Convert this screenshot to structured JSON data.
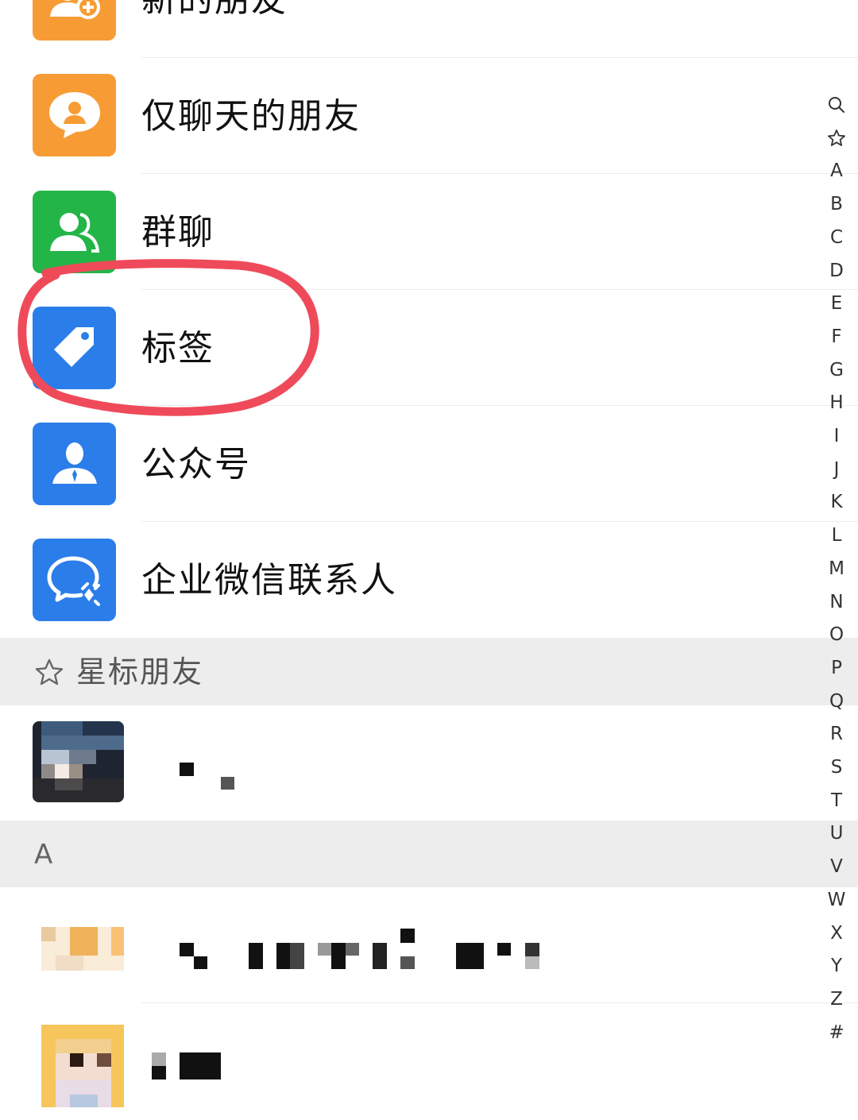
{
  "menu": {
    "items": [
      {
        "label": "新的朋友",
        "icon": "add-friend-icon",
        "color": "#f79c35"
      },
      {
        "label": "仅聊天的朋友",
        "icon": "chat-friend-icon",
        "color": "#f79c35"
      },
      {
        "label": "群聊",
        "icon": "group-chat-icon",
        "color": "#23b548"
      },
      {
        "label": "标签",
        "icon": "tag-icon",
        "color": "#2b7de9"
      },
      {
        "label": "公众号",
        "icon": "official-account-icon",
        "color": "#2b7de9"
      },
      {
        "label": "企业微信联系人",
        "icon": "work-contact-icon",
        "color": "#2b7de9"
      }
    ]
  },
  "sections": {
    "starred": {
      "title": "星标朋友",
      "icon": "star-icon"
    },
    "letter_a": {
      "title": "A"
    }
  },
  "index_bar": [
    "search",
    "star",
    "A",
    "B",
    "C",
    "D",
    "E",
    "F",
    "G",
    "H",
    "I",
    "J",
    "K",
    "L",
    "M",
    "N",
    "O",
    "P",
    "Q",
    "R",
    "S",
    "T",
    "U",
    "V",
    "W",
    "X",
    "Y",
    "Z",
    "#"
  ],
  "annotation": {
    "color": "#ef4a5a",
    "target": "标签"
  }
}
